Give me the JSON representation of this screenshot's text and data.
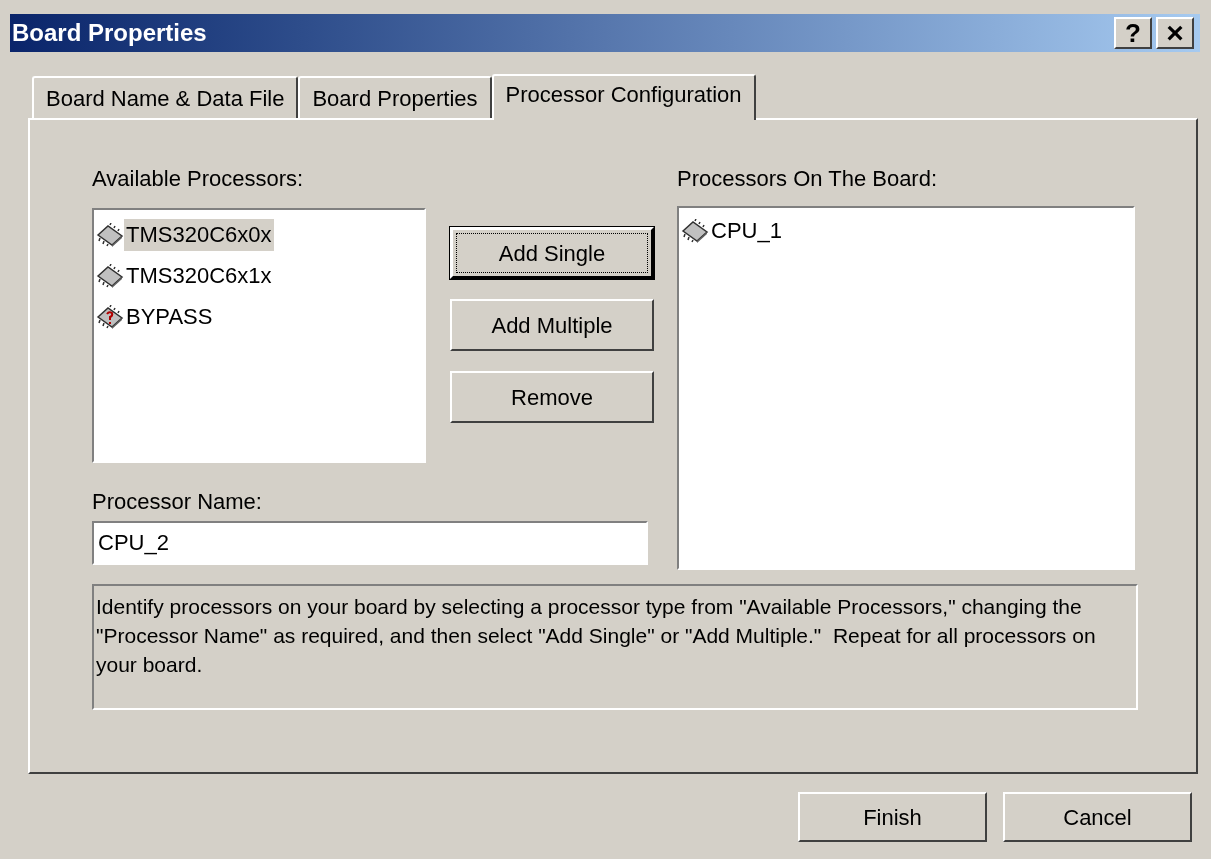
{
  "window": {
    "title": "Board Properties",
    "controls": [
      {
        "kind": "help",
        "label": "?"
      },
      {
        "kind": "close",
        "label": "×"
      }
    ]
  },
  "tabs": [
    {
      "label": "Board Name & Data File",
      "selected": false
    },
    {
      "label": "Board Properties",
      "selected": false
    },
    {
      "label": "Processor Configuration",
      "selected": true
    }
  ],
  "available": {
    "label": "Available Processors:",
    "items": [
      {
        "name": "TMS320C6x0x",
        "kind": "chip",
        "selected": true
      },
      {
        "name": "TMS320C6x1x",
        "kind": "chip",
        "selected": false
      },
      {
        "name": "BYPASS",
        "kind": "unknown",
        "selected": false
      }
    ]
  },
  "actions": [
    {
      "label": "Add Single",
      "default": true
    },
    {
      "label": "Add Multiple",
      "default": false
    },
    {
      "label": "Remove",
      "default": false
    }
  ],
  "board": {
    "label": "Processors On The Board:",
    "items": [
      {
        "name": "CPU_1",
        "kind": "chip",
        "selected": false
      }
    ]
  },
  "processor_name": {
    "label": "Processor Name:",
    "value": "CPU_2"
  },
  "description": "Identify processors on your board by selecting a processor type from \"Available Processors,\" changing the \"Processor Name\" as required, and then select \"Add Single\" or \"Add Multiple.\"  Repeat for all processors on your board.",
  "buttons": [
    "Finish",
    "Cancel"
  ]
}
